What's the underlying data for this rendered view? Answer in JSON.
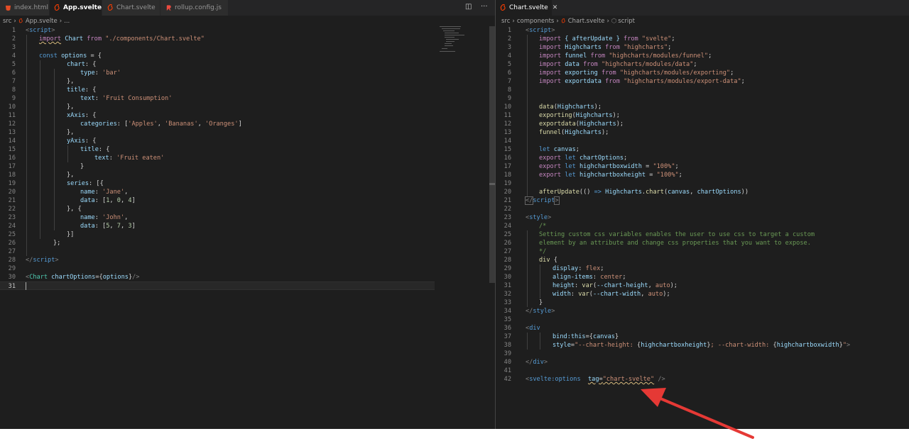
{
  "left": {
    "tabs": [
      {
        "label": "index.html",
        "active": false,
        "icon": "html-file-icon"
      },
      {
        "label": "App.svelte",
        "active": true,
        "icon": "svelte-file-icon"
      },
      {
        "label": "Chart.svelte",
        "active": false,
        "icon": "svelte-file-icon"
      },
      {
        "label": "rollup.config.js",
        "active": false,
        "icon": "rollup-file-icon"
      }
    ],
    "breadcrumb": [
      "src",
      "App.svelte",
      "..."
    ],
    "line_numbers": [
      "1",
      "2",
      "3",
      "4",
      "5",
      "6",
      "7",
      "8",
      "9",
      "10",
      "11",
      "12",
      "13",
      "14",
      "15",
      "16",
      "17",
      "18",
      "19",
      "20",
      "21",
      "22",
      "23",
      "24",
      "25",
      "26",
      "27",
      "28",
      "29",
      "30",
      "31"
    ],
    "code": {
      "l1_open": "<",
      "l1_tag": "script",
      "l1_close": ">",
      "l2_import": "import",
      "l2_name": "Chart",
      "l2_from": "from",
      "l2_path": "\"./components/Chart.svelte\"",
      "l4_const": "const",
      "l4_var": "options",
      "l4_rest": " = {",
      "l5_key": "chart",
      "l5_rest": ": {",
      "l6_key": "type",
      "l6_val": "'bar'",
      "l7": "},",
      "l8_key": "title",
      "l8_rest": ": {",
      "l9_key": "text",
      "l9_val": "'Fruit Consumption'",
      "l10": "},",
      "l11_key": "xAxis",
      "l11_rest": ": {",
      "l12_key": "categories",
      "l12_a": "'Apples'",
      "l12_b": "'Bananas'",
      "l12_c": "'Oranges'",
      "l13": "},",
      "l14_key": "yAxis",
      "l14_rest": ": {",
      "l15_key": "title",
      "l15_rest": ": {",
      "l16_key": "text",
      "l16_val": "'Fruit eaten'",
      "l17": "}",
      "l18": "},",
      "l19_key": "series",
      "l19_rest": ": [{",
      "l20_key": "name",
      "l20_val": "'Jane'",
      "l21_key": "data",
      "l21_n1": "1",
      "l21_n2": "0",
      "l21_n3": "4",
      "l22": "}, {",
      "l23_key": "name",
      "l23_val": "'John'",
      "l24_key": "data",
      "l24_n1": "5",
      "l24_n2": "7",
      "l24_n3": "3",
      "l25": "}]",
      "l26": "};",
      "l28_open": "</",
      "l28_tag": "script",
      "l28_close": ">",
      "l30_open": "<",
      "l30_tag": "Chart",
      "l30_attr": "chartOptions",
      "l30_eq": "=",
      "l30_lb": "{",
      "l30_val": "options",
      "l30_rb": "}",
      "l30_close": "/>"
    }
  },
  "right": {
    "tabs": [
      {
        "label": "Chart.svelte",
        "active": true,
        "icon": "svelte-file-icon"
      }
    ],
    "breadcrumb": [
      "src",
      "components",
      "Chart.svelte",
      "script"
    ],
    "line_numbers": [
      "1",
      "2",
      "3",
      "4",
      "5",
      "6",
      "7",
      "8",
      "9",
      "10",
      "11",
      "12",
      "13",
      "14",
      "15",
      "16",
      "17",
      "18",
      "19",
      "20",
      "21",
      "22",
      "23",
      "24",
      "25",
      "26",
      "27",
      "28",
      "29",
      "30",
      "31",
      "32",
      "33",
      "34",
      "35",
      "36",
      "37",
      "38",
      "39",
      "40",
      "41",
      "42"
    ],
    "code": {
      "import": "import",
      "from": "from",
      "r1_tag": "script",
      "r2_names": "{ afterUpdate }",
      "r2_path": "\"svelte\"",
      "r3_name": "Highcharts",
      "r3_path": "\"highcharts\"",
      "r4_name": "funnel",
      "r4_path": "\"highcharts/modules/funnel\"",
      "r5_name": "data",
      "r5_path": "\"highcharts/modules/data\"",
      "r6_name": "exporting",
      "r6_path": "\"highcharts/modules/exporting\"",
      "r7_name": "exportdata",
      "r7_path": "\"highcharts/modules/export-data\"",
      "r10_fn": "data",
      "r10_arg": "Highcharts",
      "r11_fn": "exporting",
      "r11_arg": "Highcharts",
      "r12_fn": "exportdata",
      "r12_arg": "Highcharts",
      "r13_fn": "funnel",
      "r13_arg": "Highcharts",
      "let": "let",
      "export": "export",
      "r15_var": "canvas",
      "r16_var": "chartOptions",
      "r17_var": "highchartboxwidth",
      "r17_val": "\"100%\"",
      "r18_var": "highchartboxheight",
      "r18_val": "\"100%\"",
      "r20_fn": "afterUpdate",
      "r20_arrow": "=>",
      "r20_obj": "Highcharts",
      "r20_method": "chart",
      "r20_a1": "canvas",
      "r20_a2": "chartOptions",
      "r21_tag": "script",
      "r23_tag": "style",
      "r24": "/*",
      "r25": "Setting custom css variables enables the user to use css to target a custom",
      "r26": "element by an attribute and change css properties that you want to expose.",
      "r27": "*/",
      "r28_sel": "div",
      "r29_prop": "display",
      "r29_val": "flex",
      "r30_prop": "align-items",
      "r30_val": "center",
      "r31_prop": "height",
      "r31_fn": "var",
      "r31_var": "--chart-height",
      "r31_fb": "auto",
      "r32_prop": "width",
      "r32_fn": "var",
      "r32_var": "--chart-width",
      "r32_fb": "auto",
      "r34_tag": "style",
      "r36_tag": "div",
      "r37_attr": "bind:this",
      "r37_val": "canvas",
      "r38_attr": "style",
      "r38_s1": "\"--chart-height: ",
      "r38_v1": "highchartboxheight",
      "r38_s2": "; --chart-width: ",
      "r38_v2": "highchartboxwidth",
      "r38_s3": "\"",
      "r40_tag": "div",
      "r42_tag": "svelte:options",
      "r42_attr": "tag",
      "r42_val": "\"chart-svelte\"",
      "r42_close": "/>"
    }
  },
  "colors": {
    "editor_bg": "#1e1e1e",
    "tab_inactive_bg": "#2d2d2d",
    "svelte_orange": "#ff3e00",
    "arrow_red": "#e53935"
  }
}
